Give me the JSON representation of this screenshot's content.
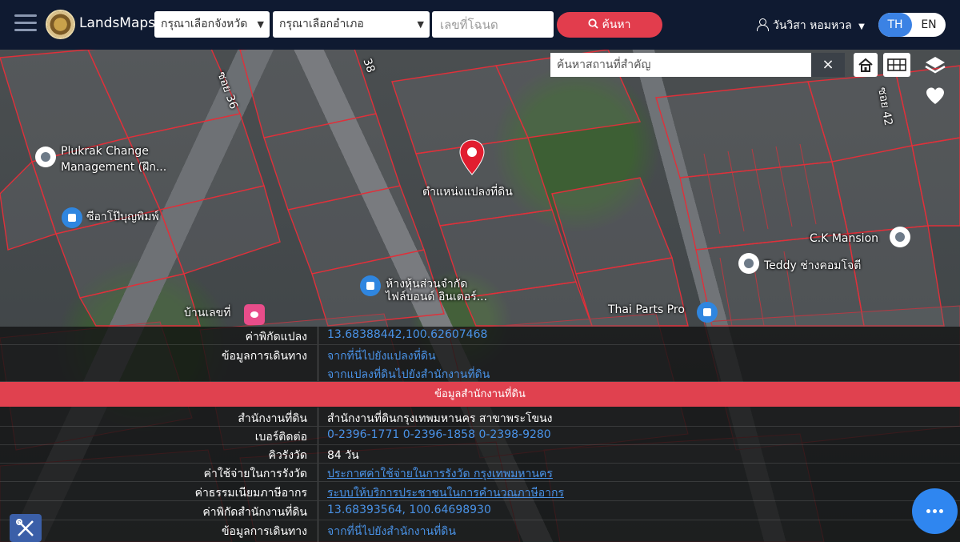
{
  "header": {
    "brand": "LandsMaps",
    "province_select": "กรุณาเลือกจังหวัด",
    "amphoe_select": "กรุณาเลือกอำเภอ",
    "deed_placeholder": "เลขที่โฉนด",
    "search_label": "ค้นหา",
    "user_name": "วันวิสา หอมหวล",
    "lang_th": "TH",
    "lang_en": "EN",
    "accent_color": "#e23d4d",
    "lang_active_color": "#3b82e4"
  },
  "map": {
    "place_search_placeholder": "ค้นหาสถานที่สำคัญ",
    "parcel_label": "ตำแหน่งแปลงที่ดิน",
    "labels": {
      "plukrak": "Plukrak Change",
      "plukrak2": "Management (ฝึก...",
      "shop1": "ซีอาโป๊บุญพิมพ์",
      "shop2": "ห้างหุ้นส่วนจำกัด",
      "shop3": "ไฟล์บอนด์ อินเตอร์...",
      "ck": "C.K Mansion",
      "teddy": "Teddy ช่างคอมโจตี",
      "thaiparts": "Thai Parts Pro",
      "home": "บ้านเลขที่",
      "road36": "ซอย 36",
      "road38": "38",
      "road42": "ซอย 42"
    },
    "icons": {
      "home": "home-icon",
      "grid": "grid-icon",
      "layers": "layers-icon",
      "favorite": "heart-icon"
    }
  },
  "panel": {
    "rows_top": [
      {
        "label": "ค่าพิกัดแปลง",
        "value": "13.68388442,100.62607468"
      },
      {
        "label": "ข้อมูลการเดินทาง",
        "value": "จากที่นี่ไปยังแปลงที่ดิน"
      },
      {
        "label": "",
        "value": "จากแปลงที่ดินไปยังสำนักงานที่ดิน"
      }
    ],
    "section_title": "ข้อมูลสำนักงานที่ดิน",
    "rows_office": [
      {
        "label": "สำนักงานที่ดิน",
        "value": "สำนักงานที่ดินกรุงเทพมหานคร สาขาพระโขนง"
      },
      {
        "label": "เบอร์ติดต่อ",
        "value": "0-2396-1771 0-2396-1858 0-2398-9280"
      },
      {
        "label": "คิวรังวัด",
        "value": "84 วัน"
      },
      {
        "label": "ค่าใช้จ่ายในการรังวัด",
        "value": "ประกาศค่าใช้จ่ายในการรังวัด กรุงเทพมหานคร"
      },
      {
        "label": "ค่าธรรมเนียมภาษีอากร",
        "value": "ระบบให้บริการประชาชนในการคำนวณภาษีอากร"
      },
      {
        "label": "ค่าพิกัดสำนักงานที่ดิน",
        "value": "13.68393564, 100.64698930"
      },
      {
        "label": "ข้อมูลการเดินทาง",
        "value": "จากที่นี่ไปยังสำนักงานที่ดิน"
      }
    ],
    "section_color": "#e0414f",
    "link_color": "#4a93e8"
  },
  "fab_icon": "more-icon",
  "tool_icon": "tools-icon"
}
